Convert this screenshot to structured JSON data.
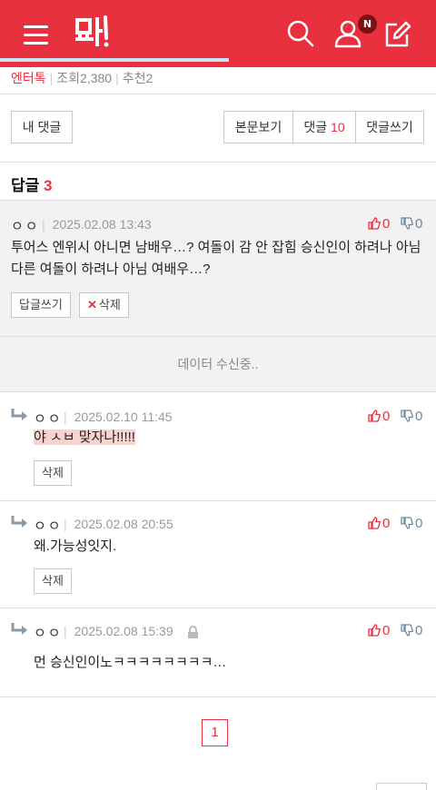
{
  "header": {
    "menu_icon": "hamburger-menu-icon",
    "logo_icon": "pann-logo",
    "search_icon": "search-icon",
    "account_icon": "user-icon",
    "account_badge": "N",
    "write_icon": "edit-icon",
    "color": "#e8303e"
  },
  "article_meta": {
    "category": "엔터톡",
    "views_label": "조회",
    "views": "2,380",
    "recommend_label": "추천",
    "recommend": "2"
  },
  "toolbar": {
    "my_comments": "내 댓글",
    "view_post": "본문보기",
    "comments_label": "댓글",
    "comments_count": "10",
    "write_comment": "댓글쓰기"
  },
  "replies": {
    "title": "답글",
    "count": "3"
  },
  "parent_comment": {
    "author": "ㅇㅇ",
    "date": "2025.02.08 13:43",
    "up": "0",
    "down": "0",
    "text": "투어스 엔위시 아니면 남배우…? 여돌이 감 안 잡힘 승신인이 하려나 아님 다른 여돌이 하려나 아님 여배우…?",
    "reply_button": "답글쓰기",
    "delete_button": "삭제"
  },
  "loading_text": "데이터 수신중..",
  "reply_items": [
    {
      "author": "ㅇㅇ",
      "date": "2025.02.10 11:45",
      "up": "0",
      "down": "0",
      "text": "야 ㅅㅂ 맞자나!!!!!",
      "delete_button": "삭제"
    },
    {
      "author": "ㅇㅇ",
      "date": "2025.02.08 20:55",
      "up": "0",
      "down": "0",
      "text": "왜.가능성잇지.",
      "delete_button": "삭제"
    },
    {
      "author": "ㅇㅇ",
      "date": "2025.02.08 15:39",
      "up": "0",
      "down": "0",
      "text": "먼 승신인이노ㅋㅋㅋㅋㅋㅋㅋㅋ…"
    }
  ],
  "pagination": {
    "current": "1"
  }
}
